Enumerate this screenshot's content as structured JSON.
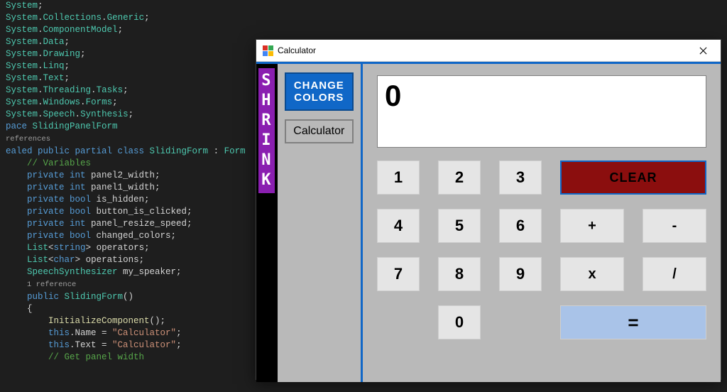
{
  "code": {
    "lines": [
      [
        [
          "tok-type",
          "System"
        ],
        [
          "",
          ";"
        ]
      ],
      [
        [
          "tok-type",
          "System"
        ],
        [
          "",
          "."
        ],
        [
          "tok-type",
          "Collections"
        ],
        [
          "",
          "."
        ],
        [
          "tok-type",
          "Generic"
        ],
        [
          "",
          ";"
        ]
      ],
      [
        [
          "tok-type",
          "System"
        ],
        [
          "",
          "."
        ],
        [
          "tok-type",
          "ComponentModel"
        ],
        [
          "",
          ";"
        ]
      ],
      [
        [
          "tok-type",
          "System"
        ],
        [
          "",
          "."
        ],
        [
          "tok-type",
          "Data"
        ],
        [
          "",
          ";"
        ]
      ],
      [
        [
          "tok-type",
          "System"
        ],
        [
          "",
          "."
        ],
        [
          "tok-type",
          "Drawing"
        ],
        [
          "",
          ";"
        ]
      ],
      [
        [
          "tok-type",
          "System"
        ],
        [
          "",
          "."
        ],
        [
          "tok-type",
          "Linq"
        ],
        [
          "",
          ";"
        ]
      ],
      [
        [
          "tok-type",
          "System"
        ],
        [
          "",
          "."
        ],
        [
          "tok-type",
          "Text"
        ],
        [
          "",
          ";"
        ]
      ],
      [
        [
          "tok-type",
          "System"
        ],
        [
          "",
          "."
        ],
        [
          "tok-type",
          "Threading"
        ],
        [
          "",
          "."
        ],
        [
          "tok-type",
          "Tasks"
        ],
        [
          "",
          ";"
        ]
      ],
      [
        [
          "tok-type",
          "System"
        ],
        [
          "",
          "."
        ],
        [
          "tok-type",
          "Windows"
        ],
        [
          "",
          "."
        ],
        [
          "tok-type",
          "Forms"
        ],
        [
          "",
          ";"
        ]
      ],
      [
        [
          "tok-type",
          "System"
        ],
        [
          "",
          "."
        ],
        [
          "tok-type",
          "Speech"
        ],
        [
          "",
          "."
        ],
        [
          "tok-type",
          "Synthesis"
        ],
        [
          "",
          ";"
        ]
      ],
      [
        [
          "",
          ""
        ]
      ],
      [
        [
          "tok-keyword",
          "pace "
        ],
        [
          "tok-type",
          "SlidingPanelForm"
        ]
      ],
      [
        [
          "",
          ""
        ]
      ],
      [
        [
          "tok-ref",
          "references"
        ]
      ],
      [
        [
          "tok-keyword",
          "ealed public partial class "
        ],
        [
          "tok-type",
          "SlidingForm"
        ],
        [
          "",
          " : "
        ],
        [
          "tok-type",
          "Form"
        ]
      ],
      [
        [
          "",
          ""
        ]
      ],
      [
        [
          "",
          "    "
        ],
        [
          "tok-comment",
          "// Variables"
        ]
      ],
      [
        [
          "",
          "    "
        ],
        [
          "tok-keyword",
          "private int"
        ],
        [
          "",
          " panel2_width;"
        ]
      ],
      [
        [
          "",
          "    "
        ],
        [
          "tok-keyword",
          "private int"
        ],
        [
          "",
          " panel1_width;"
        ]
      ],
      [
        [
          "",
          "    "
        ],
        [
          "tok-keyword",
          "private bool"
        ],
        [
          "",
          " is_hidden;"
        ]
      ],
      [
        [
          "",
          "    "
        ],
        [
          "tok-keyword",
          "private bool"
        ],
        [
          "",
          " button_is_clicked;"
        ]
      ],
      [
        [
          "",
          "    "
        ],
        [
          "tok-keyword",
          "private int"
        ],
        [
          "",
          " panel_resize_speed;"
        ]
      ],
      [
        [
          "",
          "    "
        ],
        [
          "tok-keyword",
          "private bool"
        ],
        [
          "",
          " changed_colors;"
        ]
      ],
      [
        [
          "",
          "    "
        ],
        [
          "tok-type",
          "List"
        ],
        [
          "",
          "<"
        ],
        [
          "tok-keyword",
          "string"
        ],
        [
          "",
          "> operators;"
        ]
      ],
      [
        [
          "",
          "    "
        ],
        [
          "tok-type",
          "List"
        ],
        [
          "",
          "<"
        ],
        [
          "tok-keyword",
          "char"
        ],
        [
          "",
          "> operations;"
        ]
      ],
      [
        [
          "",
          "    "
        ],
        [
          "tok-type",
          "SpeechSynthesizer"
        ],
        [
          "",
          " my_speaker;"
        ]
      ],
      [
        [
          "",
          ""
        ]
      ],
      [
        [
          "",
          "    "
        ],
        [
          "tok-ref",
          "1 reference"
        ]
      ],
      [
        [
          "",
          "    "
        ],
        [
          "tok-keyword",
          "public "
        ],
        [
          "tok-type",
          "SlidingForm"
        ],
        [
          "",
          "()"
        ]
      ],
      [
        [
          "",
          "    {"
        ]
      ],
      [
        [
          "",
          "        "
        ],
        [
          "tok-member",
          "InitializeComponent"
        ],
        [
          "",
          "();"
        ]
      ],
      [
        [
          "",
          "        "
        ],
        [
          "tok-keyword",
          "this"
        ],
        [
          "",
          ".Name = "
        ],
        [
          "tok-string",
          "\"Calculator\""
        ],
        [
          "",
          ";"
        ]
      ],
      [
        [
          "",
          "        "
        ],
        [
          "tok-keyword",
          "this"
        ],
        [
          "",
          ".Text = "
        ],
        [
          "tok-string",
          "\"Calculator\""
        ],
        [
          "",
          ";"
        ]
      ],
      [
        [
          "",
          ""
        ]
      ],
      [
        [
          "",
          "        "
        ],
        [
          "tok-comment",
          "// Get panel width"
        ]
      ]
    ]
  },
  "window": {
    "title": "Calculator"
  },
  "side": {
    "shrink": "SHRINK",
    "change_colors": "CHANGE COLORS",
    "calc_label": "Calculator"
  },
  "calc": {
    "display": "0",
    "keys": {
      "k1": "1",
      "k2": "2",
      "k3": "3",
      "k4": "4",
      "k5": "5",
      "k6": "6",
      "k7": "7",
      "k8": "8",
      "k9": "9",
      "k0": "0",
      "plus": "+",
      "minus": "-",
      "mult": "x",
      "div": "/",
      "clear": "CLEAR",
      "equals": "="
    }
  }
}
